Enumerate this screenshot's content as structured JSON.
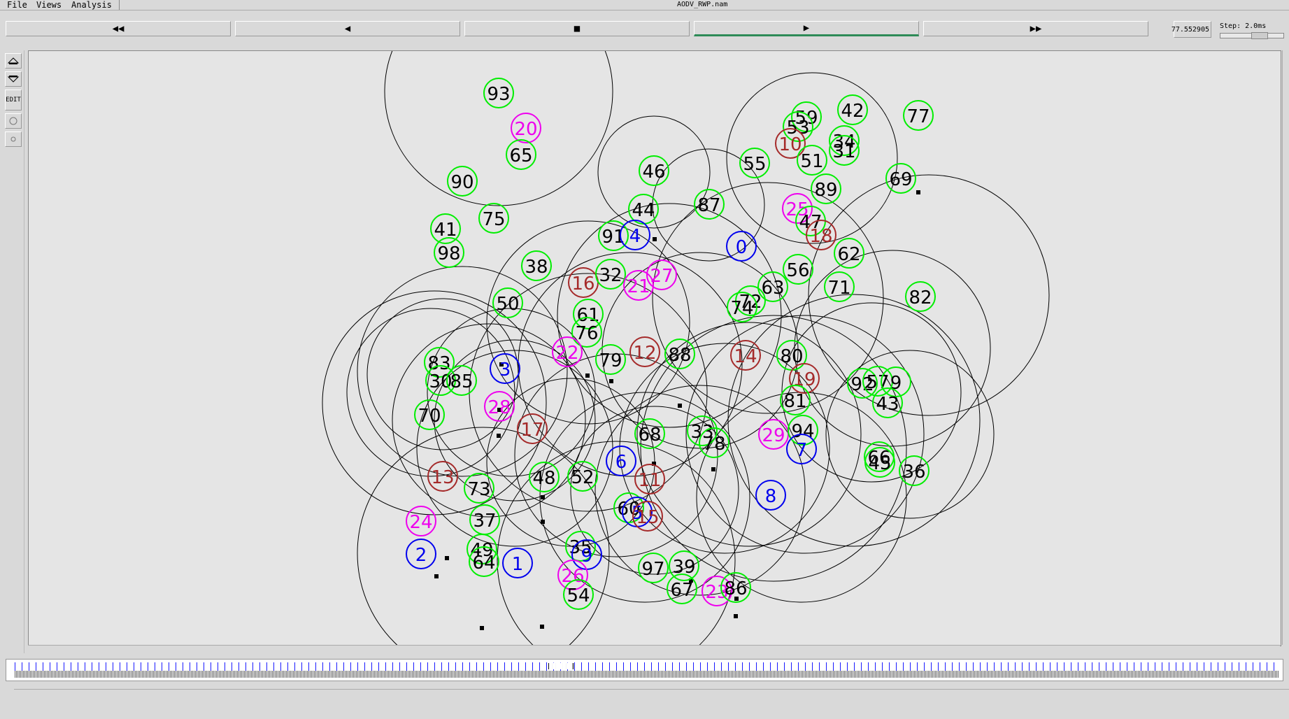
{
  "menubar": {
    "items": [
      "File",
      "Views",
      "Analysis"
    ],
    "title": "AODV_RWP.nam"
  },
  "toolbar": {
    "rewind": "◀◀",
    "back": "◀",
    "stop": "■",
    "play": "▶",
    "fastforward": "▶▶",
    "time": "77.552905",
    "step_label": "Step: 2.0ms"
  },
  "sidetools": [
    "zoom-in-icon",
    "zoom-out-icon",
    "EDIT",
    "circle-icon",
    "dot-icon"
  ],
  "timeline": {
    "marker": "███████"
  },
  "colors": {
    "green": "#00ee00",
    "magenta": "#ee00ee",
    "brown": "#a52a2a",
    "blue": "#0000ee",
    "green_text": "#000000",
    "magenta_text": "#ee00ee",
    "brown_text": "#a52a2a",
    "blue_text": "#0000ee"
  },
  "nodes": [
    {
      "id": "93",
      "type": "green"
    },
    {
      "id": "20",
      "type": "magenta"
    },
    {
      "id": "65",
      "type": "green"
    },
    {
      "id": "90",
      "type": "green"
    },
    {
      "id": "75",
      "type": "green"
    },
    {
      "id": "41",
      "type": "green"
    },
    {
      "id": "98",
      "type": "green"
    },
    {
      "id": "38",
      "type": "green"
    },
    {
      "id": "50",
      "type": "green"
    },
    {
      "id": "46",
      "type": "green"
    },
    {
      "id": "44",
      "type": "green"
    },
    {
      "id": "91",
      "type": "green"
    },
    {
      "id": "4",
      "type": "blue"
    },
    {
      "id": "87",
      "type": "green"
    },
    {
      "id": "55",
      "type": "green"
    },
    {
      "id": "59",
      "type": "green"
    },
    {
      "id": "53",
      "type": "green"
    },
    {
      "id": "10",
      "type": "brown"
    },
    {
      "id": "51",
      "type": "green"
    },
    {
      "id": "42",
      "type": "green"
    },
    {
      "id": "34",
      "type": "green"
    },
    {
      "id": "31",
      "type": "green"
    },
    {
      "id": "77",
      "type": "green"
    },
    {
      "id": "69",
      "type": "green"
    },
    {
      "id": "89",
      "type": "green"
    },
    {
      "id": "25",
      "type": "magenta"
    },
    {
      "id": "47",
      "type": "green"
    },
    {
      "id": "18",
      "type": "brown"
    },
    {
      "id": "62",
      "type": "green"
    },
    {
      "id": "0",
      "type": "blue"
    },
    {
      "id": "56",
      "type": "green"
    },
    {
      "id": "71",
      "type": "green"
    },
    {
      "id": "82",
      "type": "green"
    },
    {
      "id": "63",
      "type": "green"
    },
    {
      "id": "72",
      "type": "green"
    },
    {
      "id": "74",
      "type": "green"
    },
    {
      "id": "16",
      "type": "brown"
    },
    {
      "id": "32",
      "type": "green"
    },
    {
      "id": "21",
      "type": "magenta"
    },
    {
      "id": "27",
      "type": "magenta"
    },
    {
      "id": "61",
      "type": "green"
    },
    {
      "id": "76",
      "type": "green"
    },
    {
      "id": "22",
      "type": "magenta"
    },
    {
      "id": "79",
      "type": "green"
    },
    {
      "id": "12",
      "type": "brown"
    },
    {
      "id": "88",
      "type": "green"
    },
    {
      "id": "14",
      "type": "brown"
    },
    {
      "id": "80",
      "type": "green"
    },
    {
      "id": "19",
      "type": "brown"
    },
    {
      "id": "81",
      "type": "green"
    },
    {
      "id": "92",
      "type": "green"
    },
    {
      "id": "57",
      "type": "green"
    },
    {
      "id": "9",
      "type": "green"
    },
    {
      "id": "43",
      "type": "green"
    },
    {
      "id": "83",
      "type": "green"
    },
    {
      "id": "3",
      "type": "blue"
    },
    {
      "id": "30",
      "type": "green"
    },
    {
      "id": "85",
      "type": "green"
    },
    {
      "id": "70",
      "type": "green"
    },
    {
      "id": "28",
      "type": "magenta"
    },
    {
      "id": "17",
      "type": "brown"
    },
    {
      "id": "68",
      "type": "green"
    },
    {
      "id": "33",
      "type": "green"
    },
    {
      "id": "78",
      "type": "green"
    },
    {
      "id": "29",
      "type": "magenta"
    },
    {
      "id": "94",
      "type": "green"
    },
    {
      "id": "7",
      "type": "blue"
    },
    {
      "id": "66",
      "type": "green"
    },
    {
      "id": "45",
      "type": "green"
    },
    {
      "id": "36",
      "type": "green"
    },
    {
      "id": "6",
      "type": "blue"
    },
    {
      "id": "11",
      "type": "brown"
    },
    {
      "id": "13",
      "type": "brown"
    },
    {
      "id": "73",
      "type": "green"
    },
    {
      "id": "48",
      "type": "green"
    },
    {
      "id": "52",
      "type": "green"
    },
    {
      "id": "8",
      "type": "blue"
    },
    {
      "id": "24",
      "type": "magenta"
    },
    {
      "id": "37",
      "type": "green"
    },
    {
      "id": "60",
      "type": "green"
    },
    {
      "id": "5",
      "type": "blue"
    },
    {
      "id": "15",
      "type": "brown"
    },
    {
      "id": "2",
      "type": "blue"
    },
    {
      "id": "49",
      "type": "green"
    },
    {
      "id": "64",
      "type": "green"
    },
    {
      "id": "1",
      "type": "blue"
    },
    {
      "id": "35",
      "type": "green"
    },
    {
      "id": "9b",
      "type": "blue"
    },
    {
      "id": "26",
      "type": "magenta"
    },
    {
      "id": "54",
      "type": "green"
    },
    {
      "id": "97",
      "type": "green"
    },
    {
      "id": "39",
      "type": "green"
    },
    {
      "id": "67",
      "type": "green"
    },
    {
      "id": "23",
      "type": "magenta"
    },
    {
      "id": "86",
      "type": "green"
    }
  ]
}
